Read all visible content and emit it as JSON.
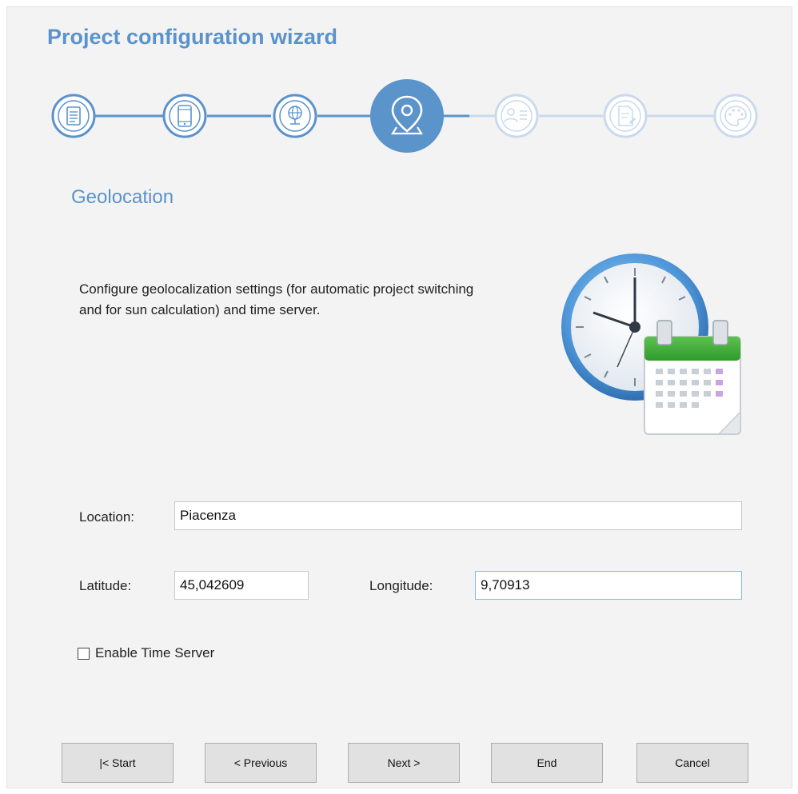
{
  "wizard": {
    "title": "Project configuration wizard",
    "steps": [
      {
        "icon": "document-list-icon",
        "state": "completed"
      },
      {
        "icon": "mobile-device-icon",
        "state": "completed"
      },
      {
        "icon": "network-globe-icon",
        "state": "completed"
      },
      {
        "icon": "location-pin-icon",
        "state": "current"
      },
      {
        "icon": "user-list-icon",
        "state": "pending"
      },
      {
        "icon": "document-edit-icon",
        "state": "pending"
      },
      {
        "icon": "palette-icon",
        "state": "pending"
      }
    ],
    "current_step_index": 3
  },
  "section": {
    "title": "Geolocation",
    "description": "Configure geolocalization settings (for automatic project switching and for sun calculation) and time server.",
    "illustration": "clock-calendar-icon"
  },
  "form": {
    "location_label": "Location:",
    "location_value": "Piacenza",
    "latitude_label": "Latitude:",
    "latitude_value": "45,042609",
    "longitude_label": "Longitude:",
    "longitude_value": "9,70913",
    "time_server_label": "Enable Time Server",
    "time_server_checked": false
  },
  "buttons": {
    "start": "|< Start",
    "previous": "< Previous",
    "next": "Next >",
    "end": "End",
    "cancel": "Cancel"
  },
  "colors": {
    "accent": "#5a93cc",
    "accent_light": "#c9daee",
    "window_bg": "#f3f3f3"
  }
}
